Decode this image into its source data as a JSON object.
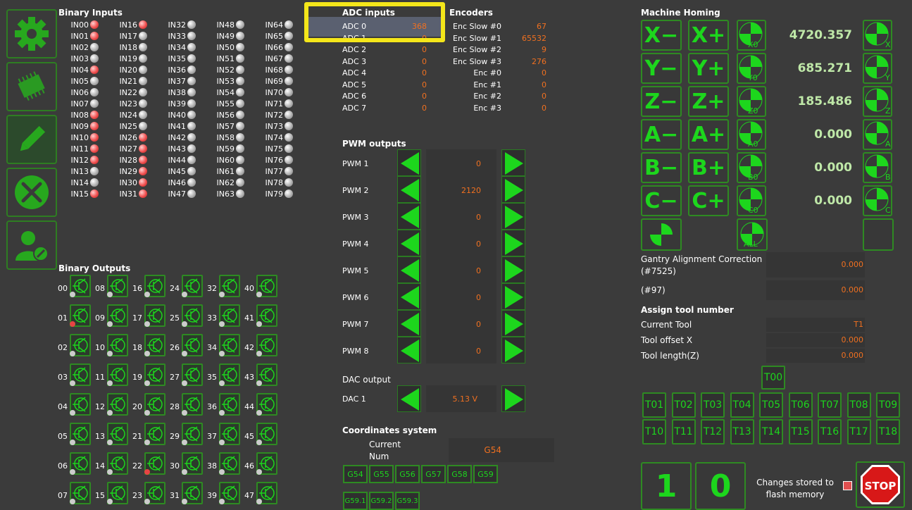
{
  "binary_inputs": {
    "title": "Binary Inputs",
    "cols": [
      [
        "IN00",
        "IN01",
        "IN02",
        "IN03",
        "IN04",
        "IN05",
        "IN06",
        "IN07",
        "IN08",
        "IN09",
        "IN10",
        "IN11",
        "IN12",
        "IN13",
        "IN14",
        "IN15"
      ],
      [
        "IN16",
        "IN17",
        "IN18",
        "IN19",
        "IN20",
        "IN21",
        "IN22",
        "IN23",
        "IN24",
        "IN25",
        "IN26",
        "IN27",
        "IN28",
        "IN29",
        "IN30",
        "IN31"
      ],
      [
        "IN32",
        "IN33",
        "IN34",
        "IN35",
        "IN36",
        "IN37",
        "IN38",
        "IN39",
        "IN40",
        "IN41",
        "IN42",
        "IN43",
        "IN44",
        "IN45",
        "IN46",
        "IN47"
      ],
      [
        "IN48",
        "IN49",
        "IN50",
        "IN51",
        "IN52",
        "IN53",
        "IN54",
        "IN55",
        "IN56",
        "IN57",
        "IN58",
        "IN59",
        "IN60",
        "IN61",
        "IN62",
        "IN63"
      ],
      [
        "IN64",
        "IN65",
        "IN66",
        "IN67",
        "IN68",
        "IN69",
        "IN70",
        "IN71",
        "IN72",
        "IN73",
        "IN74",
        "IN75",
        "IN76",
        "IN77",
        "IN78",
        "IN79"
      ]
    ],
    "active": [
      [
        1,
        1,
        0,
        0,
        1,
        0,
        0,
        0,
        1,
        1,
        1,
        1,
        1,
        0,
        0,
        1
      ],
      [
        1,
        0,
        0,
        0,
        0,
        0,
        0,
        0,
        0,
        0,
        1,
        1,
        1,
        1,
        1,
        1
      ],
      [
        0,
        0,
        0,
        0,
        0,
        0,
        0,
        0,
        0,
        0,
        0,
        0,
        0,
        0,
        0,
        0
      ],
      [
        0,
        0,
        0,
        0,
        0,
        0,
        0,
        0,
        0,
        0,
        0,
        0,
        0,
        0,
        0,
        0
      ],
      [
        0,
        0,
        0,
        0,
        0,
        0,
        0,
        0,
        0,
        0,
        0,
        0,
        0,
        0,
        0,
        0
      ]
    ]
  },
  "binary_outputs": {
    "title": "Binary Outputs",
    "cols": [
      [
        "00",
        "01",
        "02",
        "03",
        "04",
        "05",
        "06",
        "07"
      ],
      [
        "08",
        "09",
        "10",
        "11",
        "12",
        "13",
        "14",
        "15"
      ],
      [
        "16",
        "17",
        "18",
        "19",
        "20",
        "21",
        "22",
        "23"
      ],
      [
        "24",
        "25",
        "26",
        "27",
        "28",
        "29",
        "30",
        "31"
      ],
      [
        "32",
        "33",
        "34",
        "35",
        "36",
        "37",
        "38",
        "39"
      ],
      [
        "40",
        "41",
        "42",
        "43",
        "44",
        "45",
        "46",
        "47"
      ]
    ],
    "active": [
      "01",
      "22"
    ]
  },
  "adc": {
    "title": "ADC inputs",
    "rows": [
      [
        "ADC 0",
        "368"
      ],
      [
        "ADC 1",
        "0"
      ],
      [
        "ADC 2",
        "0"
      ],
      [
        "ADC 3",
        "0"
      ],
      [
        "ADC 4",
        "0"
      ],
      [
        "ADC 5",
        "0"
      ],
      [
        "ADC 6",
        "0"
      ],
      [
        "ADC 7",
        "0"
      ]
    ]
  },
  "encoders": {
    "title": "Encoders",
    "rows": [
      [
        "Enc Slow #0",
        "67"
      ],
      [
        "Enc Slow #1",
        "65532"
      ],
      [
        "Enc Slow #2",
        "9"
      ],
      [
        "Enc Slow #3",
        "276"
      ],
      [
        "Enc #0",
        "0"
      ],
      [
        "Enc #1",
        "0"
      ],
      [
        "Enc #2",
        "0"
      ],
      [
        "Enc #3",
        "0"
      ]
    ]
  },
  "pwm": {
    "title": "PWM outputs",
    "rows": [
      [
        "PWM 1",
        "0"
      ],
      [
        "PWM 2",
        "2120"
      ],
      [
        "PWM 3",
        "0"
      ],
      [
        "PWM 4",
        "0"
      ],
      [
        "PWM 5",
        "0"
      ],
      [
        "PWM 6",
        "0"
      ],
      [
        "PWM 7",
        "0"
      ],
      [
        "PWM 8",
        "0"
      ]
    ]
  },
  "dac": {
    "title": "DAC output",
    "label": "DAC 1",
    "value": "5.13 V"
  },
  "coords": {
    "title": "Coordinates system",
    "current_label": "Current\nNum",
    "current": "G54",
    "buttons": [
      "G54",
      "G55",
      "G56",
      "G57",
      "G58",
      "G59"
    ],
    "buttons2": [
      "G59.1",
      "G59.2",
      "G59.3"
    ]
  },
  "homing": {
    "title": "Machine Homing",
    "axes": [
      {
        "minus": "X−",
        "plus": "X+",
        "home": "X0",
        "value": "4720.357",
        "side": "X"
      },
      {
        "minus": "Y−",
        "plus": "Y+",
        "home": "Y0",
        "value": "685.271",
        "side": "Y"
      },
      {
        "minus": "Z−",
        "plus": "Z+",
        "home": "Z0",
        "value": "185.486",
        "side": "Z"
      },
      {
        "minus": "A−",
        "plus": "A+",
        "home": "A0",
        "value": "0.000",
        "side": "A"
      },
      {
        "minus": "B−",
        "plus": "B+",
        "home": "B0",
        "value": "0.000",
        "side": "B"
      },
      {
        "minus": "C−",
        "plus": "C+",
        "home": "C0",
        "value": "0.000",
        "side": "C"
      }
    ],
    "all": "ALL"
  },
  "gantry": {
    "label": "Gantry Alignment Correction\n(#7525)",
    "value": "0.000",
    "label2": "(#97)",
    "value2": "0.000"
  },
  "tool": {
    "title": "Assign tool number",
    "rows": [
      [
        "Current Tool",
        "T1"
      ],
      [
        "Tool offset X",
        "0.000"
      ],
      [
        "Tool length(Z)",
        "0.000"
      ]
    ],
    "t00": "T00",
    "row1": [
      "T01",
      "T02",
      "T03",
      "T04",
      "T05",
      "T06",
      "T07",
      "T08",
      "T09"
    ],
    "row2": [
      "T10",
      "T11",
      "T12",
      "T13",
      "T14",
      "T15",
      "T16",
      "T17",
      "T18"
    ]
  },
  "footer": {
    "b1": "1",
    "b2": "0",
    "flash": "Changes stored to flash memory",
    "stop": "STOP"
  },
  "colors": {
    "accent": "#1dd61d",
    "border": "#2e8a22",
    "value": "#f07020",
    "highlight": "#f4e61a"
  }
}
